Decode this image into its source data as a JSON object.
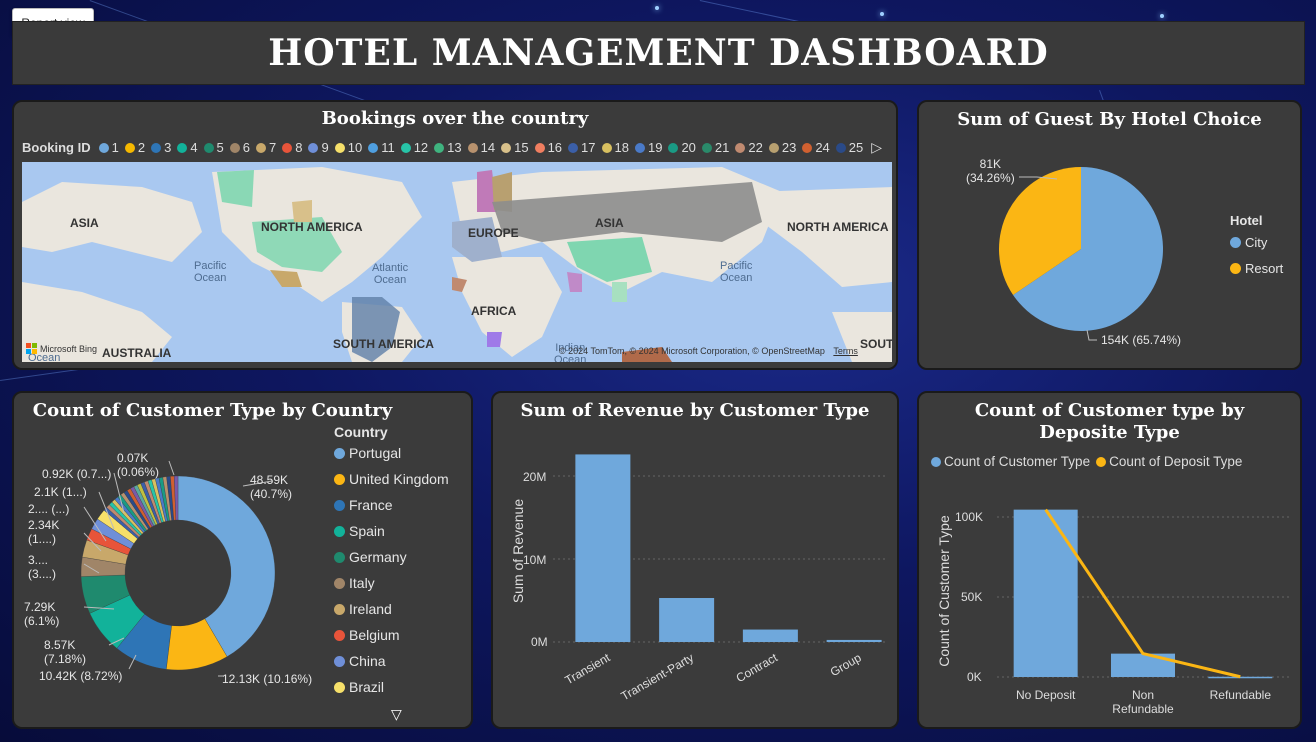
{
  "report_view_label": "Report view",
  "dashboard_title": "HOTEL MANAGEMENT DASHBOARD",
  "map_panel": {
    "title": "Bookings over the country",
    "legend_title": "Booking ID",
    "legend_items": [
      {
        "label": "1",
        "color": "#6fa8dc"
      },
      {
        "label": "2",
        "color": "#f5b800"
      },
      {
        "label": "3",
        "color": "#2e75b6"
      },
      {
        "label": "4",
        "color": "#12b29a"
      },
      {
        "label": "5",
        "color": "#1f8a6e"
      },
      {
        "label": "6",
        "color": "#a08568"
      },
      {
        "label": "7",
        "color": "#c8a86a"
      },
      {
        "label": "8",
        "color": "#e8543a"
      },
      {
        "label": "9",
        "color": "#6f8fd8"
      },
      {
        "label": "10",
        "color": "#f6e06a"
      },
      {
        "label": "11",
        "color": "#4f9fe0"
      },
      {
        "label": "12",
        "color": "#27c4a8"
      },
      {
        "label": "13",
        "color": "#3fb37f"
      },
      {
        "label": "14",
        "color": "#b8926e"
      },
      {
        "label": "15",
        "color": "#d8c08a"
      },
      {
        "label": "16",
        "color": "#f07e60"
      },
      {
        "label": "17",
        "color": "#3b5fa8"
      },
      {
        "label": "18",
        "color": "#d8c060"
      },
      {
        "label": "19",
        "color": "#4a7ac8"
      },
      {
        "label": "20",
        "color": "#1a9a84"
      },
      {
        "label": "21",
        "color": "#2a8a6a"
      },
      {
        "label": "22",
        "color": "#c08a70"
      },
      {
        "label": "23",
        "color": "#b8a070"
      },
      {
        "label": "24",
        "color": "#d06030"
      },
      {
        "label": "25",
        "color": "#2a4a88"
      }
    ],
    "continent_labels": [
      "ASIA",
      "NORTH AMERICA",
      "EUROPE",
      "ASIA",
      "NORTH AMERICA",
      "AFRICA",
      "AUSTRALIA",
      "SOUTH AMERICA",
      "SOUT"
    ],
    "ocean_labels": [
      "Pacific\nOcean",
      "Atlantic\nOcean",
      "Pacific\nOcean",
      "Indian\nOcean",
      "Ocean"
    ],
    "bing_logo": "Microsoft Bing",
    "attribution": "© 2024 TomTom, © 2024 Microsoft Corporation, © OpenStreetMap",
    "terms": "Terms"
  },
  "hotel_panel": {
    "title": "Sum of Guest By Hotel Choice",
    "legend_title": "Hotel",
    "legend": [
      {
        "label": "City",
        "color": "#6fa8dc"
      },
      {
        "label": "Resort",
        "color": "#fbb614"
      }
    ],
    "labels": {
      "resort": "81K\n(34.26%)",
      "city": "154K (65.74%)"
    }
  },
  "country_panel": {
    "title": "Count of Customer Type by Country",
    "legend_title": "Country",
    "legend": [
      {
        "label": "Portugal",
        "color": "#6fa8dc"
      },
      {
        "label": "United Kingdom",
        "color": "#fbb614"
      },
      {
        "label": "France",
        "color": "#2e75b6"
      },
      {
        "label": "Spain",
        "color": "#12b29a"
      },
      {
        "label": "Germany",
        "color": "#1f8a6e"
      },
      {
        "label": "Italy",
        "color": "#a08568"
      },
      {
        "label": "Ireland",
        "color": "#c8a86a"
      },
      {
        "label": "Belgium",
        "color": "#e8543a"
      },
      {
        "label": "China",
        "color": "#6f8fd8"
      },
      {
        "label": "Brazil",
        "color": "#f6e06a"
      }
    ],
    "labels": [
      "48.59K\n(40.7%)",
      "12.13K (10.16%)",
      "10.42K (8.72%)",
      "8.57K\n(7.18%)",
      "7.29K\n(6.1%)",
      "3....\n(3....)",
      "2.34K\n(1....)",
      "2.... (...)",
      "2.1K (1...)",
      "0.92K (0.7...)",
      "0.07K\n(0.06%)"
    ]
  },
  "revenue_panel": {
    "title": "Sum of Revenue by Customer Type",
    "ylabel": "Sum of Revenue",
    "yticks": [
      "20M",
      "10M",
      "0M"
    ]
  },
  "deposit_panel": {
    "title": "Count of Customer type by Deposite Type",
    "legend": [
      {
        "label": "Count of Customer Type",
        "color": "#6fa8dc"
      },
      {
        "label": "Count of Deposit Type",
        "color": "#fbb614"
      }
    ],
    "ylabel": "Count of Customer Type",
    "yticks": [
      "100K",
      "50K",
      "0K"
    ]
  },
  "chart_data": [
    {
      "type": "pie",
      "title": "Sum of Guest By Hotel Choice",
      "categories": [
        "City",
        "Resort"
      ],
      "values": [
        154000,
        81000
      ],
      "percent": [
        65.74,
        34.26
      ]
    },
    {
      "type": "pie",
      "title": "Count of Customer Type by Country",
      "categories": [
        "Portugal",
        "United Kingdom",
        "France",
        "Spain",
        "Germany",
        "Italy",
        "Ireland",
        "Belgium",
        "China",
        "Brazil"
      ],
      "values": [
        48590,
        12130,
        10420,
        8570,
        7290,
        3760,
        3380,
        2340,
        2200,
        2100
      ],
      "percent": [
        40.7,
        10.16,
        8.72,
        7.18,
        6.1,
        3.15,
        2.83,
        1.96,
        1.84,
        1.76
      ]
    },
    {
      "type": "bar",
      "title": "Sum of Revenue by Customer Type",
      "categories": [
        "Transient",
        "Transient-Party",
        "Contract",
        "Group"
      ],
      "values": [
        22600000,
        5300000,
        1500000,
        250000
      ],
      "ylabel": "Sum of Revenue",
      "ylim": [
        0,
        24000000
      ]
    },
    {
      "type": "bar",
      "title": "Count of Customer type by Deposite Type",
      "categories": [
        "No Deposit",
        "Non Refundable",
        "Refundable"
      ],
      "series": [
        {
          "name": "Count of Customer Type",
          "type": "bar",
          "values": [
            104600,
            14600,
            160
          ]
        },
        {
          "name": "Count of Deposit Type",
          "type": "line",
          "values": [
            104600,
            14600,
            160
          ]
        }
      ],
      "ylabel": "Count of Customer Type",
      "ylim": [
        0,
        110000
      ]
    }
  ]
}
